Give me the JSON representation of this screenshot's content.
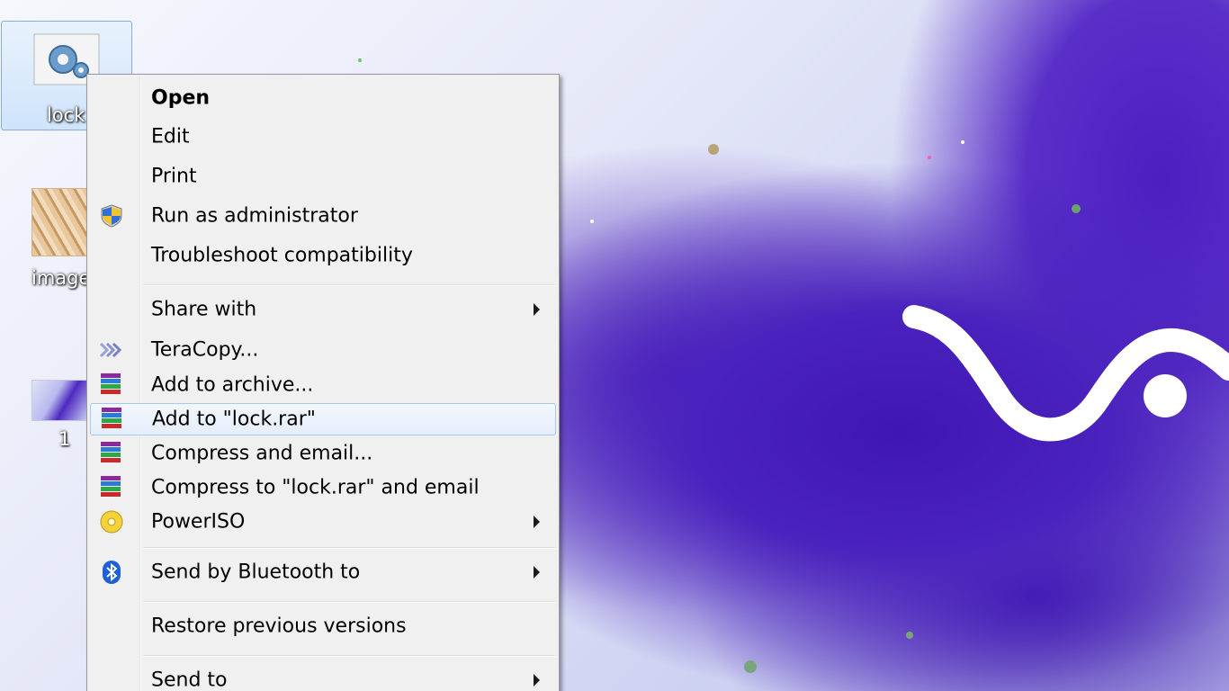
{
  "desktop": {
    "icons": [
      {
        "label": "lock",
        "icon": "gear-icon",
        "selected": true
      },
      {
        "label": "image",
        "icon": "image-thumbnail-icon"
      },
      {
        "label": "1",
        "icon": "image-thumbnail-icon"
      }
    ]
  },
  "context_menu": {
    "items": [
      {
        "label": "Open",
        "bold": true
      },
      {
        "label": "Edit"
      },
      {
        "label": "Print"
      },
      {
        "label": "Run as administrator",
        "icon": "uac-shield-icon"
      },
      {
        "label": "Troubleshoot compatibility"
      },
      {
        "label": "Share with",
        "submenu": true
      },
      {
        "label": "TeraCopy...",
        "icon": "teracopy-icon"
      },
      {
        "label": "Add to archive...",
        "icon": "winrar-icon"
      },
      {
        "label": "Add to \"lock.rar\"",
        "icon": "winrar-icon",
        "highlighted": true
      },
      {
        "label": "Compress and email...",
        "icon": "winrar-icon"
      },
      {
        "label": "Compress to \"lock.rar\" and email",
        "icon": "winrar-icon"
      },
      {
        "label": "PowerISO",
        "icon": "poweriso-icon",
        "submenu": true
      },
      {
        "label": "Send by Bluetooth to",
        "icon": "bluetooth-icon",
        "submenu": true
      },
      {
        "label": "Restore previous versions"
      },
      {
        "label": "Send to",
        "submenu": true
      }
    ]
  },
  "colors": {
    "menu_bg": "#f0f0f0",
    "highlight_border": "#a8c8ee",
    "wallpaper_purple": "#4a1fb8"
  }
}
